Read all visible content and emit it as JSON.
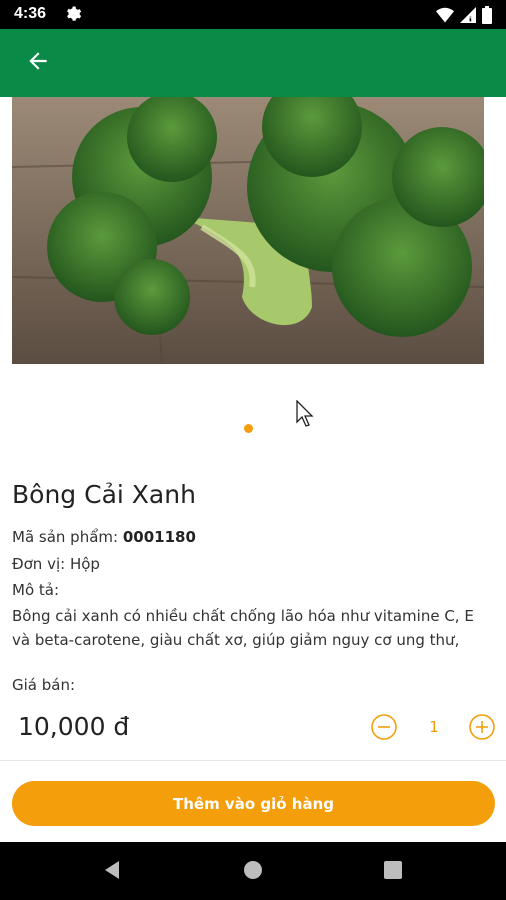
{
  "status_bar": {
    "time": "4:36"
  },
  "product": {
    "name": "Bông Cải Xanh",
    "code_label": "Mã sản phẩm:",
    "code_value": "0001180",
    "unit_label": "Đơn vị:",
    "unit_value": "Hộp",
    "desc_label": "Mô tả:",
    "description": "Bông cải xanh có nhiều chất chống lão hóa như vitamine C, E và beta-carotene, giàu chất xơ, giúp giảm nguy cơ ung thư,",
    "price_label": "Giá bán:",
    "price_value": "10,000 đ",
    "quantity": "1"
  },
  "actions": {
    "add_to_cart": "Thêm vào giỏ hàng"
  },
  "colors": {
    "app_bar": "#0a8a47",
    "accent": "#f59e0b"
  },
  "icons": {
    "back": "arrow-left-icon",
    "minus": "minus-circle-icon",
    "plus": "plus-circle-icon"
  }
}
